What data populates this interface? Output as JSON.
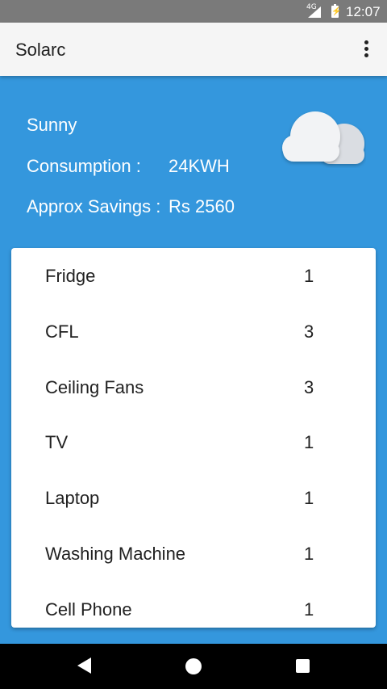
{
  "status_bar": {
    "network_label": "4G",
    "time": "12:07"
  },
  "app_bar": {
    "title": "Solarc",
    "menu_icon": "more-vert-icon"
  },
  "weather": {
    "condition": "Sunny",
    "consumption_label": "Consumption :",
    "consumption_value": "24KWH",
    "savings_label": "Approx Savings :",
    "savings_value": "Rs 2560",
    "icon": "cloud-icon"
  },
  "appliances": [
    {
      "name": "Fridge",
      "count": "1"
    },
    {
      "name": "CFL",
      "count": "3"
    },
    {
      "name": "Ceiling Fans",
      "count": "3"
    },
    {
      "name": "TV",
      "count": "1"
    },
    {
      "name": "Laptop",
      "count": "1"
    },
    {
      "name": "Washing Machine",
      "count": "1"
    },
    {
      "name": "Cell Phone",
      "count": "1"
    }
  ],
  "colors": {
    "primary": "#3497DD",
    "app_bar": "#F5F5F5",
    "status_bar": "#7A7A7A"
  }
}
